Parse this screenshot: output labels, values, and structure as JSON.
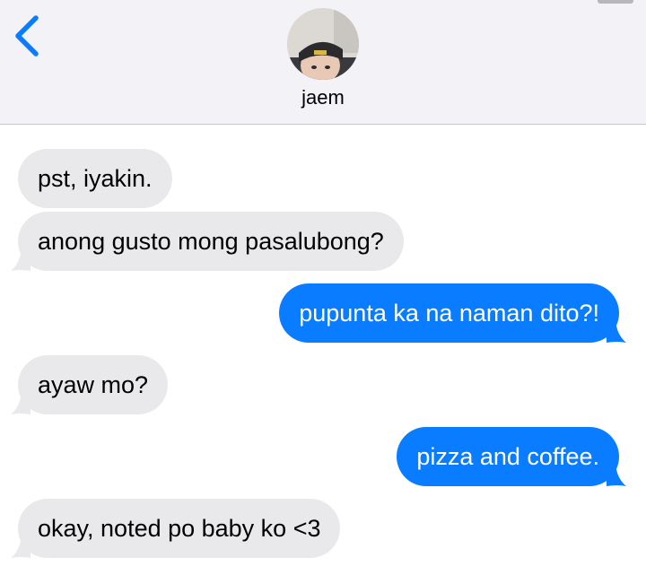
{
  "header": {
    "contact_name": "jaem",
    "back_icon": "chevron-left-icon",
    "accent_color": "#0a7cff"
  },
  "messages": [
    {
      "from": "contact",
      "text": "pst, iyakin."
    },
    {
      "from": "contact",
      "text": "anong gusto mong pasalubong?"
    },
    {
      "from": "me",
      "text": "pupunta ka na naman dito?!"
    },
    {
      "from": "contact",
      "text": "ayaw mo?"
    },
    {
      "from": "me",
      "text": "pizza and coffee."
    },
    {
      "from": "contact",
      "text": "okay, noted po baby ko <3"
    }
  ]
}
